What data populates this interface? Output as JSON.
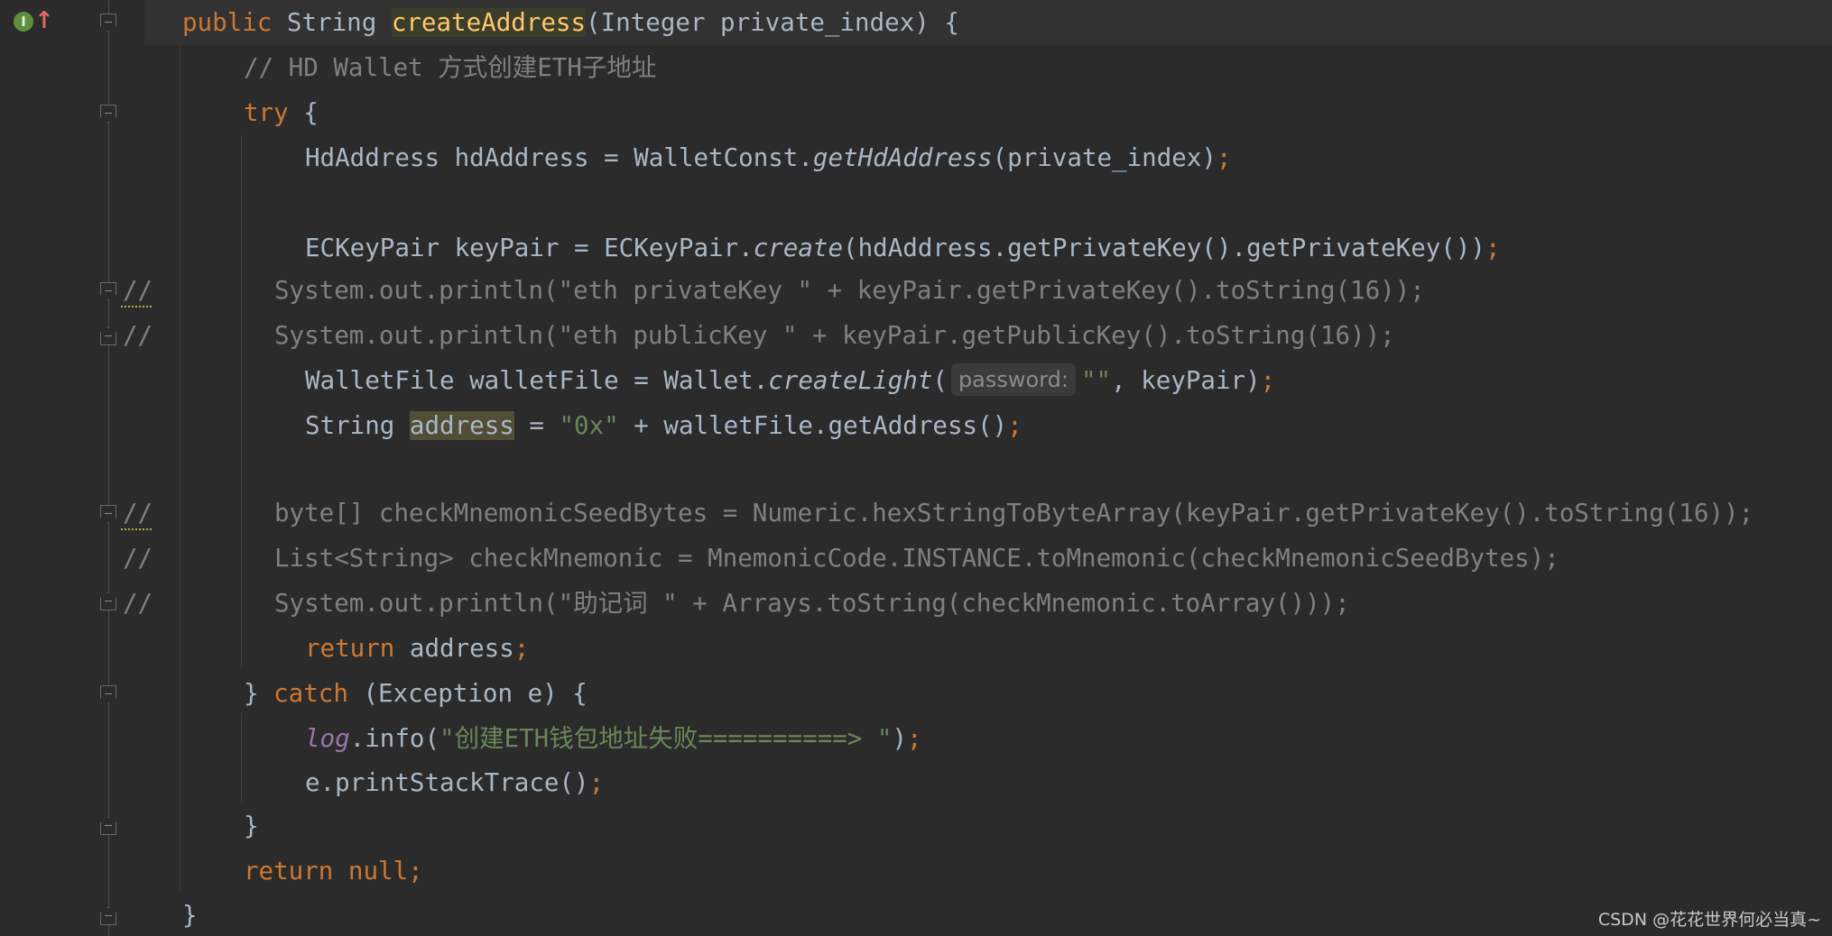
{
  "lines": {
    "l1": {
      "kw_public": "public ",
      "type": "String ",
      "method": "createAddress",
      "rest": "(Integer private_index) {"
    },
    "l2": {
      "comment": "// HD Wallet 方式创建ETH子地址"
    },
    "l3": {
      "kw": "try",
      "rest": " {"
    },
    "l4": {
      "pre": "HdAddress hdAddress = WalletConst.",
      "call": "getHdAddress",
      "post": "(private_index)",
      "semi": ";"
    },
    "l5": {
      "pre": "ECKeyPair keyPair = ECKeyPair.",
      "call": "create",
      "post": "(hdAddress.getPrivateKey().getPrivateKey())",
      "semi": ";"
    },
    "l6": {
      "gutter": "//",
      "text": "System.out.println(\"eth privateKey \" + keyPair.getPrivateKey().toString(16));"
    },
    "l7": {
      "gutter": "//",
      "text": "System.out.println(\"eth publicKey \" + keyPair.getPublicKey().toString(16));"
    },
    "l8": {
      "pre": "WalletFile walletFile = Wallet.",
      "call": "createLight",
      "paren": "(",
      "hint": "password:",
      "str": "\"\"",
      "post": ", keyPair)",
      "semi": ";"
    },
    "l9": {
      "pre": "String ",
      "var": "address",
      "eq": " = ",
      "str": "\"0x\"",
      "post": " + walletFile.getAddress()",
      "semi": ";"
    },
    "l10": {
      "gutter": "//",
      "text": "byte[] checkMnemonicSeedBytes = Numeric.hexStringToByteArray(keyPair.getPrivateKey().toString(16));"
    },
    "l11": {
      "gutter": "//",
      "text": "List<String> checkMnemonic = MnemonicCode.INSTANCE.toMnemonic(checkMnemonicSeedBytes);"
    },
    "l12": {
      "gutter": "//",
      "text": "System.out.println(\"助记词 \" + Arrays.toString(checkMnemonic.toArray()));"
    },
    "l13": {
      "kw": "return",
      "rest": " address",
      "semi": ";"
    },
    "l14": {
      "brace": "} ",
      "kw": "catch",
      "rest": " (Exception e) {"
    },
    "l15": {
      "field": "log",
      "pre": ".info(",
      "str": "\"创建ETH钱包地址失败==========> \"",
      "post": ")",
      "semi": ";"
    },
    "l16": {
      "text": "e.printStackTrace()",
      "semi": ";"
    },
    "l17": {
      "text": "}"
    },
    "l18": {
      "kw": "return null",
      "semi": ";"
    },
    "l19": {
      "text": "}"
    }
  },
  "gutter": {
    "impl_icon_label": "I",
    "override_arrow": "↑"
  },
  "watermark": "CSDN @花花世界何必当真~",
  "colors": {
    "background": "#2b2b2b",
    "keyword": "#cc7832",
    "method_decl": "#ffc66d",
    "string": "#6a8759",
    "comment": "#808080",
    "text": "#a9b7c6",
    "field": "#9876aa"
  }
}
